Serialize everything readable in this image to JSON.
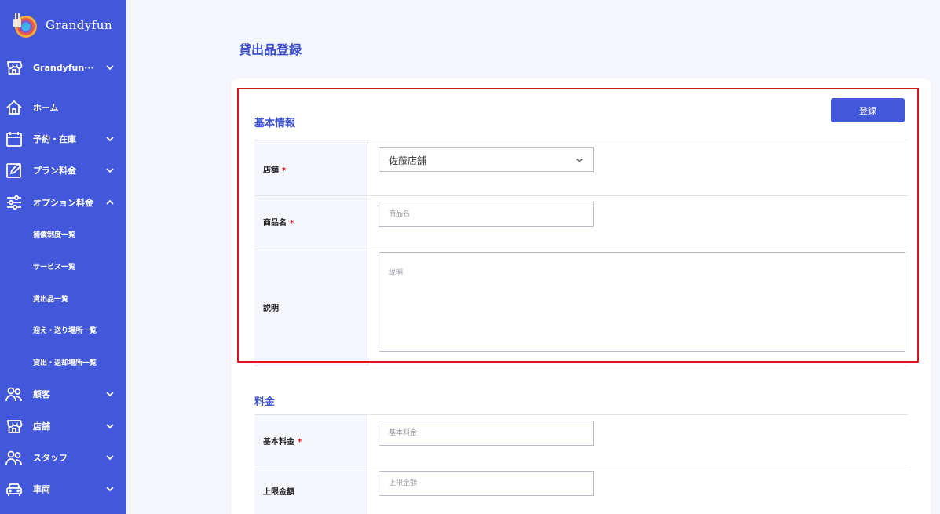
{
  "brand": {
    "name": "Grandyfun"
  },
  "sidebar": {
    "items": [
      {
        "key": "store-switch",
        "label": "Grandyfun···",
        "icon": "store-icon",
        "chevron": "down"
      },
      {
        "key": "home",
        "label": "ホーム",
        "icon": "home-icon",
        "chevron": ""
      },
      {
        "key": "reservation",
        "label": "予約・在庫",
        "icon": "calendar-icon",
        "chevron": "down"
      },
      {
        "key": "plan",
        "label": "プラン料金",
        "icon": "edit-icon",
        "chevron": "down"
      },
      {
        "key": "option",
        "label": "オプション料金",
        "icon": "sliders-icon",
        "chevron": "up"
      },
      {
        "key": "customer",
        "label": "顧客",
        "icon": "users-icon",
        "chevron": "down"
      },
      {
        "key": "store",
        "label": "店舗",
        "icon": "store-icon",
        "chevron": "down"
      },
      {
        "key": "staff",
        "label": "スタッフ",
        "icon": "users-icon",
        "chevron": "down"
      },
      {
        "key": "vehicle",
        "label": "車両",
        "icon": "car-icon",
        "chevron": "down"
      }
    ],
    "option_sub_items": [
      "補償制度一覧",
      "サービス一覧",
      "貸出品一覧",
      "迎え・送り場所一覧",
      "貸出・返却場所一覧"
    ]
  },
  "page": {
    "title": "貸出品登録"
  },
  "form": {
    "submit_label": "登録",
    "basic_section": {
      "title": "基本情報",
      "store_label": "店舗",
      "store_value": "佐藤店舗",
      "product_label": "商品名",
      "product_placeholder": "商品名",
      "description_label": "説明",
      "description_placeholder": "説明"
    },
    "price_section": {
      "title": "料金",
      "base_price_label": "基本料金",
      "base_price_placeholder": "基本料金",
      "max_price_label": "上限金額",
      "max_price_placeholder": "上限金額"
    },
    "required_mark": "*"
  },
  "colors": {
    "sidebar": "#4257d9",
    "accent": "#3c50d2",
    "required": "#e0141e",
    "highlight": "#e0141e"
  }
}
